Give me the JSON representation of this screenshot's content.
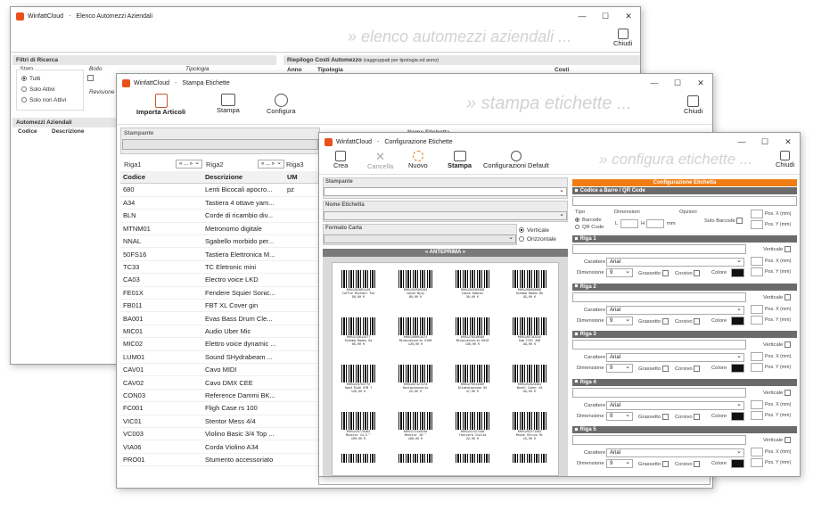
{
  "w1": {
    "app": "WinfattCloud",
    "title": "Elenco Automezzi Aziendali",
    "banner": "» elenco automezzi aziendali ...",
    "close_label": "Chiudi",
    "filters_title": "Filtri di Ricerca",
    "stato_label": "Stato",
    "stato_opts": [
      "Tutti",
      "Solo Attivi",
      "Solo non Attivi"
    ],
    "bollo_label": "Bollo",
    "revisione_label": "Revisione",
    "tipologia_label": "Tipologia",
    "riepilogo_title": "Riepilogo Costi Automezzo",
    "riepilogo_note": "(raggruppati per tipologia ed anno)",
    "cols": [
      "Anno",
      "Tipologia",
      "Costi"
    ],
    "automezzi_title": "Automezzi Aziendali",
    "auto_cols": [
      "Codice",
      "Descrizione"
    ]
  },
  "w2": {
    "app": "WinfattCloud",
    "title": "Stampa Etichette",
    "banner": "» stampa etichette ...",
    "toolbar": {
      "importa": "Importa Articoli",
      "stampa": "Stampa",
      "configura": "Configura",
      "chiudi": "Chiudi"
    },
    "stampante_label": "Stampante",
    "nome_label": "Nome Etichetta",
    "riga1": "Riga1",
    "riga2": "Riga2",
    "riga3": "Riga3",
    "nav": "« ... »",
    "cols": [
      "Codice",
      "Descrizione",
      "UM"
    ],
    "rows": [
      [
        "680",
        "Lenti Bicocali apocro...",
        "pz"
      ],
      [
        "A34",
        "Tastiera 4 ottave yam...",
        ""
      ],
      [
        "BLN",
        "Corde di ricambio div...",
        ""
      ],
      [
        "MTNM01",
        "Metronomo digitale",
        ""
      ],
      [
        "NNAL",
        "Sgabello morbido per...",
        ""
      ],
      [
        "50FS16",
        "Tastiera Elettronica M...",
        ""
      ],
      [
        "TC33",
        "TC Eletronic mini",
        ""
      ],
      [
        "CA03",
        "Electro voice LKD",
        ""
      ],
      [
        "FE01X",
        "Fendere Squier Sonic...",
        ""
      ],
      [
        "FB011",
        "FBT XL Cover gin",
        ""
      ],
      [
        "BA001",
        "Evas Bass Drum Cle...",
        ""
      ],
      [
        "MIC01",
        "Audio Uber Mic",
        ""
      ],
      [
        "MIC02",
        "Elettro voice dynamic ...",
        ""
      ],
      [
        "LUM01",
        "Sound SHydrabeam ...",
        ""
      ],
      [
        "CAV01",
        "Cavo MIDI",
        ""
      ],
      [
        "CAV02",
        "Cavo DMX CEE",
        ""
      ],
      [
        "CON03",
        "Reference Dammi BK...",
        ""
      ],
      [
        "FC001",
        "Fligh Case  rs 100",
        ""
      ],
      [
        "VIC01",
        "Stentor Mess 4/4",
        ""
      ],
      [
        "VC003",
        "Violino Basic 3/4 Top ...",
        ""
      ],
      [
        "VIA06",
        "Corda Violino A34",
        ""
      ],
      [
        "PRO01",
        "Stumento accessoriato",
        ""
      ]
    ]
  },
  "w3": {
    "app": "WinfattCloud",
    "title": "Configurazione Etichette",
    "banner": "» configura etichette ...",
    "toolbar": {
      "crea": "Crea",
      "cancella": "Cancella",
      "nuovo": "Nuovo",
      "stampa": "Stampa",
      "config": "Configurazioni Default",
      "chiudi": "Chiudi"
    },
    "stampante_label": "Stampante",
    "nome_label": "Nome Etichetta",
    "formato_label": "Formato Carta",
    "verticale": "Verticale",
    "orizzontale": "Orizzontale",
    "anteprima": "« ANTEPRIMA »",
    "config_title": "Configurazione Etichetta",
    "codice_barre": "Codice a Barre / QR Code",
    "tipo": "Tipo",
    "barcode": "Barcode",
    "qrcode": "QR Code",
    "dimensioni": "Dimensioni",
    "L": "L",
    "H": "H",
    "mm": "mm",
    "opzioni": "Opzioni",
    "solo_barcode": "Solo Barcode",
    "posx": "Pos. X (mm)",
    "posy": "Pos. Y (mm)",
    "righe": [
      "Riga 1",
      "Riga 2",
      "Riga 3",
      "Riga 4",
      "Riga 5"
    ],
    "verticale_chk": "Verticale",
    "carattere": "Carattere",
    "font": "Arial",
    "dimensione": "Dimensione",
    "size": "9",
    "grassetto": "Grassetto",
    "corsivo": "Corsivo",
    "colore": "Colore",
    "labels": [
      [
        "0001262602120",
        "Cuffie Michael Tse",
        "90,00 €"
      ],
      [
        "0001262590283",
        "Casse Mysy",
        "60,00 €"
      ],
      [
        "0001262560469",
        "Casse Kawtec",
        "30,00 €"
      ],
      [
        "0001268099969",
        "Schema Radeo Bk",
        "95,00 €"
      ],
      [
        "0001213612477",
        "Schema Radeo Sa",
        "65,00 €"
      ],
      [
        "0001288053472",
        "Mixaccessorio 5108",
        "120,00 €"
      ],
      [
        "0001270230569",
        "Mixaccessorio 6010",
        "130,00 €"
      ],
      [
        "0001265782415",
        "Sam IIXI 408",
        "99,00 €"
      ],
      [
        "0001224754772",
        "Hand Ride HTB 7",
        "120,00 €"
      ],
      [
        "0001297127473",
        "Hostaccessorio",
        "25,00 €"
      ],
      [
        "0001275014480",
        "Alimentazione 9V",
        "47,00 €"
      ],
      [
        "0001252923491",
        "Bonel Cuber 10",
        "95,00 €"
      ],
      [
        "0001224779462",
        "Monitor 21,5''",
        "100,00 €"
      ],
      [
        "0001272140249",
        "Monitor 19''",
        "190,00 €"
      ],
      [
        "0001241127446",
        "Tastiera Italia",
        "22,00 €"
      ],
      [
        "0001202271402",
        "Mouse Ottico RL",
        "15,00 €"
      ]
    ]
  }
}
